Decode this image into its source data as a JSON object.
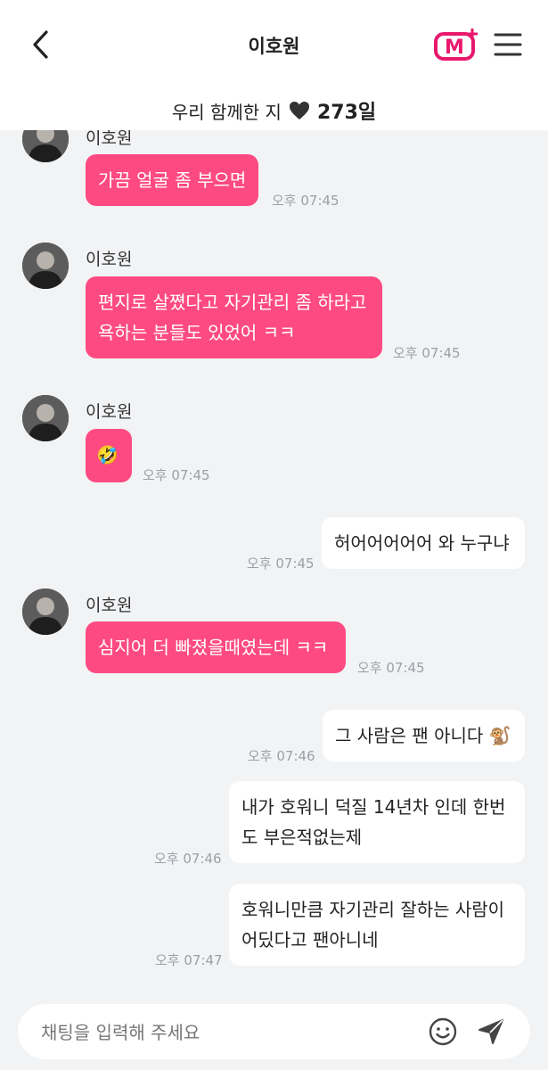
{
  "header": {
    "title": "이호원",
    "back_icon": "chevron-left-icon",
    "logo": "mnet-plus-logo",
    "menu_icon": "hamburger-menu-icon"
  },
  "together": {
    "label": "우리 함께한 지",
    "heart_icon": "heart-icon",
    "days": "273일"
  },
  "messages": [
    {
      "direction": "in",
      "sender": "이호원",
      "text": "가끔 얼굴 좀 부으면",
      "time": "오후 07:45"
    },
    {
      "direction": "in",
      "sender": "이호원",
      "text": "편지로 살쪘다고 자기관리 좀 하라고 욕하는 분들도 있었어 ㅋㅋ",
      "time": "오후 07:45"
    },
    {
      "direction": "in",
      "sender": "이호원",
      "text": "🤣",
      "time": "오후 07:45"
    },
    {
      "direction": "out",
      "text": "허어어어어어 와 누구냐",
      "time": "오후 07:45"
    },
    {
      "direction": "in",
      "sender": "이호원",
      "text": "심지어 더 빠졌을때였는데 ㅋㅋ",
      "time": "오후 07:45"
    },
    {
      "direction": "out",
      "text": "그 사람은 팬 아니다 🐒",
      "time": "오후 07:46"
    },
    {
      "direction": "out",
      "text": "내가 호워니 덕질 14년차 인데 한번도 부은적없는제",
      "time": "오후 07:46"
    },
    {
      "direction": "out",
      "text": "호워니만큼 자기관리 잘하는 사람이 어딨다고 팬아니네",
      "time": "오후 07:47"
    }
  ],
  "input": {
    "placeholder": "채팅을 입력해 주세요",
    "value": "",
    "emoji_icon": "smiley-icon",
    "send_icon": "send-icon"
  },
  "colors": {
    "accent": "#fe4a82",
    "background": "#f2f3f5",
    "outgoing_bubble": "#ffffff",
    "time_text": "#9aa0a8"
  }
}
